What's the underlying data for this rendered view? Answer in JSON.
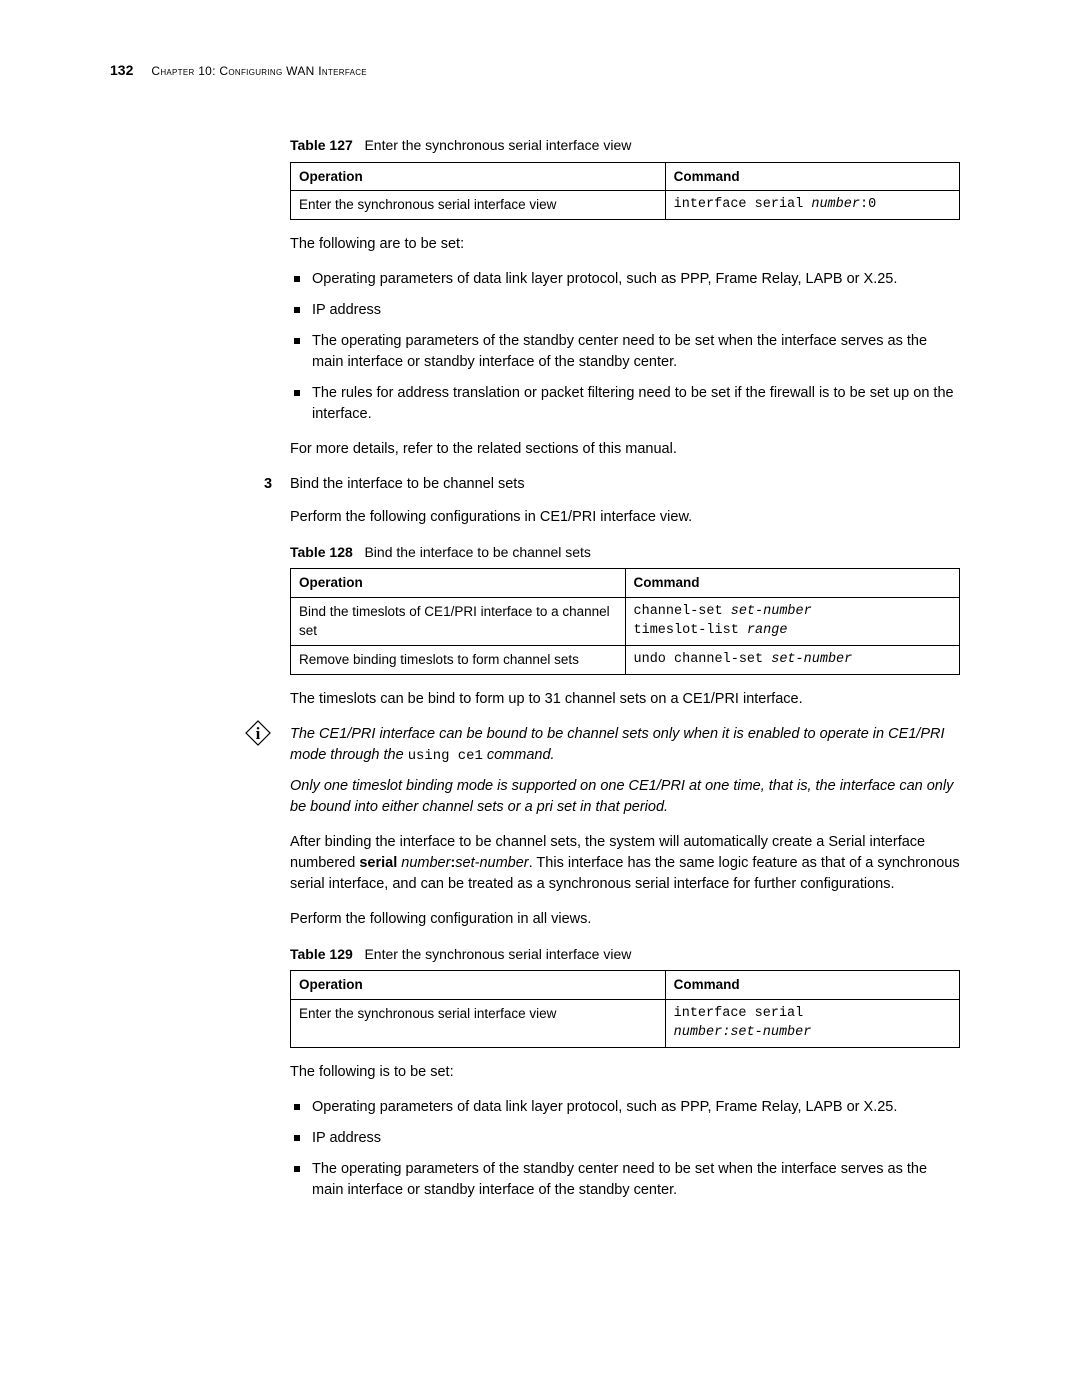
{
  "header": {
    "page_number": "132",
    "chapter": "Chapter 10: Configuring WAN Interface"
  },
  "table127": {
    "caption_label": "Table 127",
    "caption_text": "Enter the synchronous serial interface view",
    "headers": [
      "Operation",
      "Command"
    ],
    "rows": [
      {
        "op": "Enter the synchronous serial interface view",
        "cmd_pre": "interface serial ",
        "cmd_it": "number",
        "cmd_post": ":0"
      }
    ]
  },
  "para_following1": "The following are to be set:",
  "list1": [
    "Operating parameters of data link layer protocol, such as PPP, Frame Relay, LAPB or X.25.",
    "IP address",
    "The operating parameters of the standby center need to be set when the interface serves as the main interface or standby interface of the standby center.",
    "The rules for address translation or packet filtering need to be set if the firewall is to be set up on the interface."
  ],
  "para_more_details": "For more details, refer to the related sections of this manual.",
  "step3": {
    "num": "3",
    "title": "Bind the interface to be channel sets",
    "intro": "Perform the following configurations in CE1/PRI interface view."
  },
  "table128": {
    "caption_label": "Table 128",
    "caption_text": "Bind the interface to be channel sets",
    "headers": [
      "Operation",
      "Command"
    ],
    "rows": [
      {
        "op": "Bind the timeslots of CE1/PRI interface to a channel set",
        "cmd_pre1": "channel-set ",
        "cmd_it1": "set-number",
        "cmd_pre2": "timeslot-list ",
        "cmd_it2": "range"
      },
      {
        "op": "Remove binding timeslots to form channel sets",
        "cmd_pre": "undo channel-set ",
        "cmd_it": "set-number"
      }
    ]
  },
  "para_timeslots": "The timeslots can be bind to form up to 31 channel sets on a CE1/PRI interface.",
  "note1_a": "The CE1/PRI interface can be bound to be channel sets only when it is enabled to operate in CE1/PRI mode through the ",
  "note1_mono": "using ce1",
  "note1_b": " command.",
  "note2": "Only one timeslot binding mode is supported on one CE1/PRI at one time, that is, the interface can only be bound into either channel sets or a pri set in that period.",
  "para_after_binding_a": "After binding the interface to be channel sets, the system will automatically create a Serial interface numbered ",
  "para_after_binding_bold": "serial",
  "para_after_binding_space": " ",
  "para_after_binding_it": "number",
  "para_after_binding_bold2": ":",
  "para_after_binding_it2": "set-number",
  "para_after_binding_b": ". This interface has the same logic feature as that of a synchronous serial interface, and can be treated as a synchronous serial interface for further configurations.",
  "para_perform_all": "Perform the following configuration in all views.",
  "table129": {
    "caption_label": "Table 129",
    "caption_text": "Enter the synchronous serial interface view",
    "headers": [
      "Operation",
      "Command"
    ],
    "rows": [
      {
        "op": "Enter the synchronous serial interface view",
        "cmd_pre": "interface serial",
        "cmd_it": "number:set-number"
      }
    ]
  },
  "para_following2": "The following is to be set:",
  "list2": [
    "Operating parameters of data link layer protocol, such as PPP, Frame Relay, LAPB or X.25.",
    "IP address",
    "The operating parameters of the standby center need to be set when the interface serves as the main interface or standby interface of the standby center."
  ]
}
